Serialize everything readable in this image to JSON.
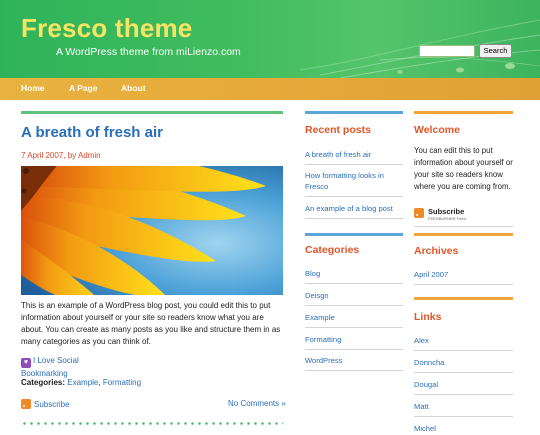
{
  "header": {
    "title": "Fresco theme",
    "tagline": "A WordPress theme from miLienzo.com",
    "search_button": "Search",
    "search_value": ""
  },
  "nav": {
    "items": [
      {
        "label": "Home"
      },
      {
        "label": "A Page"
      },
      {
        "label": "About"
      }
    ]
  },
  "post": {
    "title": "A breath of fresh air",
    "date": "7 April 2007",
    "by": ", by ",
    "author": "Admin",
    "body": "This is an example of a WordPress blog post, you could edit this to put information about yourself or your site so readers know what you are about. You can create as many posts as you like and structure them in as many categories as you can think of.",
    "social_label_1": "I Love Social",
    "social_label_2": "Bookmarking",
    "categories_label": "Categories:",
    "categories": [
      "Example",
      "Formatting"
    ],
    "subscribe": "Subscribe",
    "comments": "No Comments »"
  },
  "sidebar": {
    "recent_posts": {
      "title": "Recent posts",
      "items": [
        "A breath of fresh air",
        "How formatting looks in",
        "Fresco",
        "An example of a blog post"
      ]
    },
    "categories": {
      "title": "Categories",
      "items": [
        "Blog",
        "Deisgn",
        "Example",
        "Formatting",
        "WordPress"
      ]
    },
    "welcome": {
      "title": "Welcome",
      "text": "You can edit this to put information about yourself or your site so readers know where you are coming from.",
      "badge": "Subscribe",
      "badge_sub": "FEEDBURNER Feed"
    },
    "archives": {
      "title": "Archives",
      "items": [
        "April 2007"
      ]
    },
    "links": {
      "title": "Links",
      "items": [
        "Alex",
        "Donncha",
        "Dougal",
        "Matt",
        "Michel"
      ]
    }
  },
  "colors": {
    "header_green": "#41bd5e",
    "title_yellow": "#f7e463",
    "nav_orange": "#e6a93a",
    "link_blue": "#2a6fb8",
    "heading_red": "#e0562b"
  }
}
